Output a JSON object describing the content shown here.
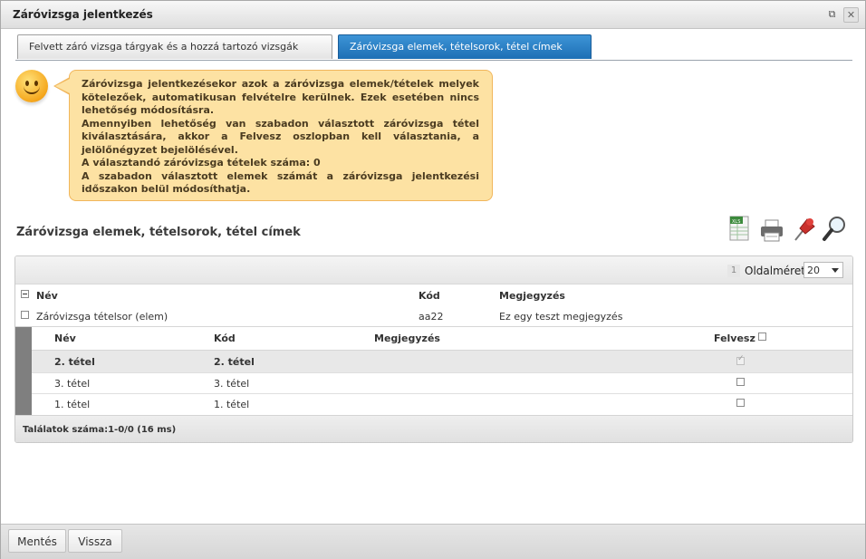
{
  "window": {
    "title": "Záróvizsga jelentkezés",
    "maximize_glyph": "⧉",
    "close_glyph": "✕"
  },
  "tabs": [
    {
      "label": "Felvett záró vizsga tárgyak és a hozzá tartozó vizsgák",
      "active": false
    },
    {
      "label": "Záróvizsga elemek, tételsorok, tétel címek",
      "active": true
    }
  ],
  "info": {
    "lines": [
      "Záróvizsga jelentkezésekor azok a záróvizsga elemek/tételek melyek kötelezőek, automatikusan felvételre kerülnek. Ezek esetében nincs lehetőség módosításra.",
      "Amennyiben lehetőség van szabadon választott záróvizsga tétel kiválasztására, akkor a Felvesz oszlopban kell választania, a jelölőnégyzet bejelölésével.",
      "A választandó záróvizsga tételek száma: 0",
      "A szabadon választott elemek számát a záróvizsga jelentkezési időszakon belül módosíthatja."
    ]
  },
  "section": {
    "title": "Záróvizsga elemek, tételsorok, tétel címek",
    "tools": [
      "excel-export-icon",
      "print-icon",
      "pin-icon",
      "search-icon"
    ]
  },
  "grid": {
    "pager": {
      "current_page": "1",
      "page_size_label": "Oldalméret",
      "page_size_value": "20"
    },
    "columns": {
      "name": "Név",
      "code": "Kód",
      "note": "Megjegyzés"
    },
    "row": {
      "name": "Záróvizsga tételsor (elem)",
      "code": "aa22",
      "note": "Ez egy teszt megjegyzés"
    },
    "sub": {
      "columns": {
        "name": "Név",
        "code": "Kód",
        "note": "Megjegyzés",
        "take": "Felvesz"
      },
      "rows": [
        {
          "name": "2. tétel",
          "code": "2. tétel",
          "note": "",
          "checked": true,
          "disabled": true
        },
        {
          "name": "3. tétel",
          "code": "3. tétel",
          "note": "",
          "checked": false,
          "disabled": false
        },
        {
          "name": "1. tétel",
          "code": "1. tétel",
          "note": "",
          "checked": false,
          "disabled": false
        }
      ]
    },
    "result_text": "Találatok száma:1-0/0 (16 ms)"
  },
  "buttons": {
    "save": "Mentés",
    "back": "Vissza"
  },
  "colors": {
    "active_tab": "#2a7fc4",
    "info_bg": "#fde2a3",
    "info_border": "#f1b65b"
  }
}
